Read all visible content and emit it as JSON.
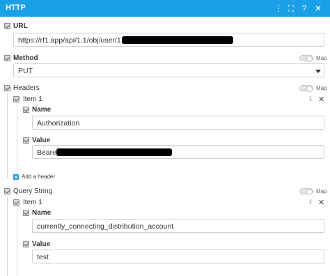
{
  "window": {
    "title": "HTTP",
    "accent_color": "#1aa0e6",
    "icons": [
      "kebab-icon",
      "expand-icon",
      "help-icon",
      "close-icon"
    ]
  },
  "url": {
    "label": "URL",
    "value": "https://rf1.app/api/1.1/obj/user/1"
  },
  "method": {
    "label": "Method",
    "value": "PUT",
    "map_label": "Map"
  },
  "headers": {
    "label": "Headers",
    "map_label": "Map",
    "items": [
      {
        "title": "Item 1",
        "name_label": "Name",
        "name_value": "Authorization",
        "value_label": "Value",
        "value_value": "Bearer"
      }
    ],
    "add_label": "Add a header"
  },
  "query_string": {
    "label": "Query String",
    "map_label": "Map",
    "items": [
      {
        "title": "Item 1",
        "name_label": "Name",
        "name_value": "currently_connecting_distribution_account",
        "value_label": "Value",
        "value_value": "test"
      }
    ]
  }
}
